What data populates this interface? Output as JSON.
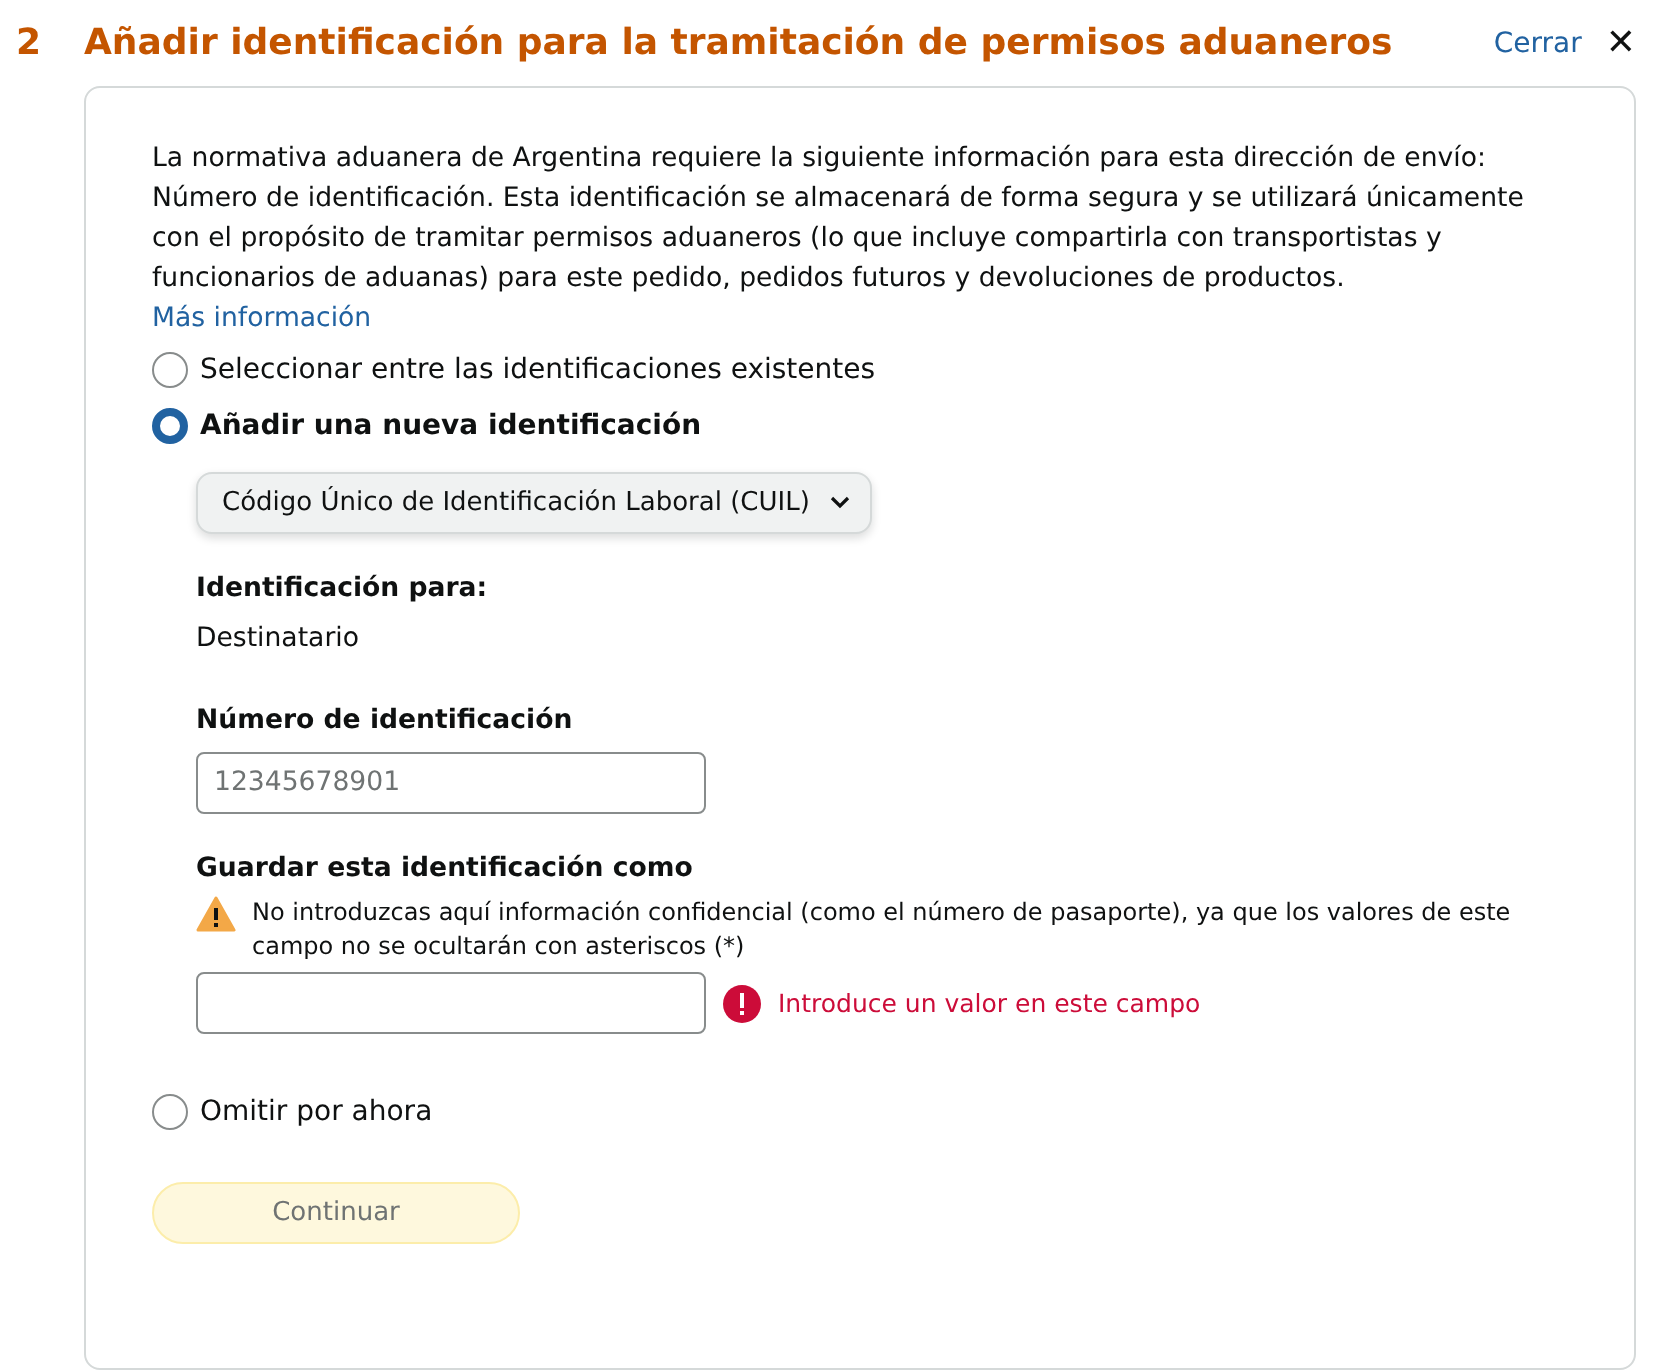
{
  "header": {
    "step": "2",
    "title": "Añadir identificación para la tramitación de permisos aduaneros",
    "close_link": "Cerrar",
    "close_icon": "✕"
  },
  "notice": {
    "text": "La normativa aduanera de Argentina requiere la siguiente información para esta dirección de envío: Número de identificación. Esta identificación se almacenará de forma segura y se utilizará únicamente con el propósito de tramitar permisos aduaneros (lo que incluye compartirla con transportistas y funcionarios de aduanas) para este pedido, pedidos futuros y devoluciones de productos.",
    "link": "Más información"
  },
  "options": [
    {
      "kind": "plain",
      "label": "Seleccionar entre las identificaciones existentes",
      "selected": false
    },
    {
      "kind": "add",
      "label": "Añadir una nueva identificación",
      "selected": true
    },
    {
      "kind": "plain",
      "label": "Omitir por ahora",
      "selected": false
    }
  ],
  "new_id_form": {
    "id_type": "Código Único de Identificación Laboral (CUIL)",
    "for_label": "Identificación para:",
    "for_value": "Destinatario",
    "number_label": "Número de identificación",
    "number_placeholder": "12345678901",
    "save_label": "Guardar esta identificación como",
    "warning": "No introduzcas aquí información confidencial (como el número de pasaporte), ya que los valores de este campo no se ocultarán con asteriscos (*)",
    "error": "Introduce un valor en este campo"
  },
  "continue_button": {
    "label": "Continuar",
    "disabled": true
  }
}
